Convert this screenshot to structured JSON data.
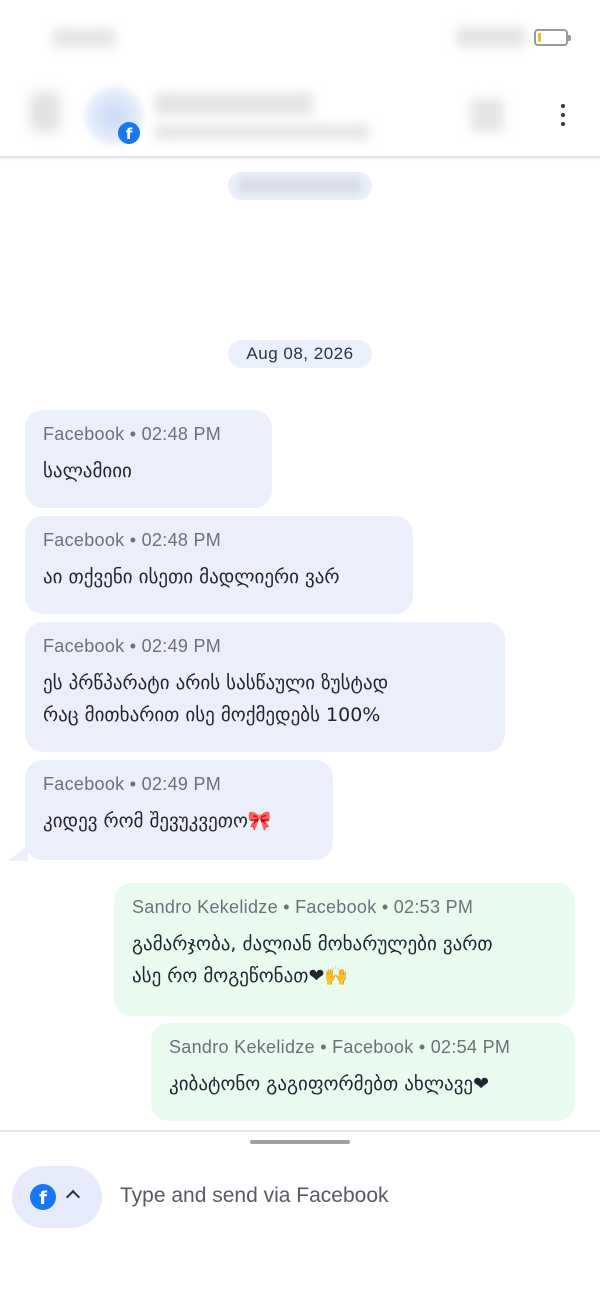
{
  "colors": {
    "incoming_bubble": "#ebeffb",
    "outgoing_bubble": "#e9fbef",
    "facebook_blue": "#1877f2",
    "date_pill": "#eaf0fb"
  },
  "header": {
    "avatar_channel_icon": "facebook-icon",
    "more_icon": "vertical-dots-icon"
  },
  "chat": {
    "date_separator": "Aug 08, 2026",
    "messages": [
      {
        "direction": "incoming",
        "meta": "Facebook • 02:48 PM",
        "text": "სალამიიი"
      },
      {
        "direction": "incoming",
        "meta": "Facebook • 02:48 PM",
        "text": "აი თქვენი ისეთი მადლიერი ვარ"
      },
      {
        "direction": "incoming",
        "meta": "Facebook • 02:49 PM",
        "text": "ეს პრწპარატი არის სასწაული ზუსტად\nრაც მითხარით ისე მოქმედებს 100%"
      },
      {
        "direction": "incoming",
        "meta": "Facebook • 02:49 PM",
        "text": "კიდევ რომ შევუკვეთო🎀"
      },
      {
        "direction": "outgoing",
        "meta": "Sandro Kekelidze • Facebook • 02:53 PM",
        "text": "გამარჯობა, ძალიან მოხარულები ვართ\nასე რო მოგეწონათ❤🙌"
      },
      {
        "direction": "outgoing",
        "meta": "Sandro Kekelidze • Facebook • 02:54 PM",
        "text": "კიბატონო გაგიფორმებთ ახლავე❤"
      }
    ]
  },
  "composer": {
    "channel_icon": "facebook-icon",
    "placeholder": "Type and send via Facebook"
  }
}
